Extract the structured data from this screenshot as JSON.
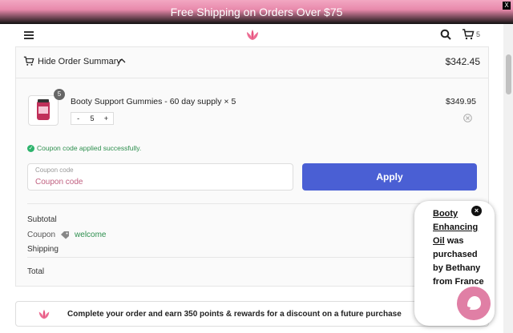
{
  "promo": {
    "text": "Free Shipping on Orders Over $75",
    "close": "X"
  },
  "header": {
    "cart_count": "5"
  },
  "order_summary": {
    "toggle_label": "Hide Order Summary",
    "total": "$342.45",
    "item": {
      "name": "Booty Support Gummies - 60 day supply × 5",
      "price": "$349.95",
      "badge_qty": "5",
      "qty_minus": "-",
      "qty_value": "5",
      "qty_plus": "+"
    },
    "coupon_message": "Coupon code applied successfully.",
    "coupon_field": {
      "label": "Coupon code",
      "placeholder": "Coupon code"
    },
    "apply_label": "Apply",
    "rows": {
      "subtotal_label": "Subtotal",
      "coupon_label": "Coupon",
      "coupon_code": "welcome",
      "shipping_label": "Shipping",
      "total_label": "Total"
    }
  },
  "points_banner": {
    "text": "Complete your order and earn 350 points & rewards for a discount on a future purchase"
  },
  "popup": {
    "product": "Booty Enhancing Oil",
    "mid": "was purchased by",
    "name": "Bethany",
    "from": "from",
    "location": "France",
    "close": "×"
  },
  "colors": {
    "accent": "#4a5fd4",
    "brand_pink": "#e07fa5",
    "success": "#2db36c"
  },
  "icons": [
    "hamburger-icon",
    "lotus-logo-icon",
    "search-icon",
    "cart-icon",
    "chevron-up-icon",
    "remove-icon",
    "check-icon",
    "tag-icon",
    "chat-icon"
  ]
}
